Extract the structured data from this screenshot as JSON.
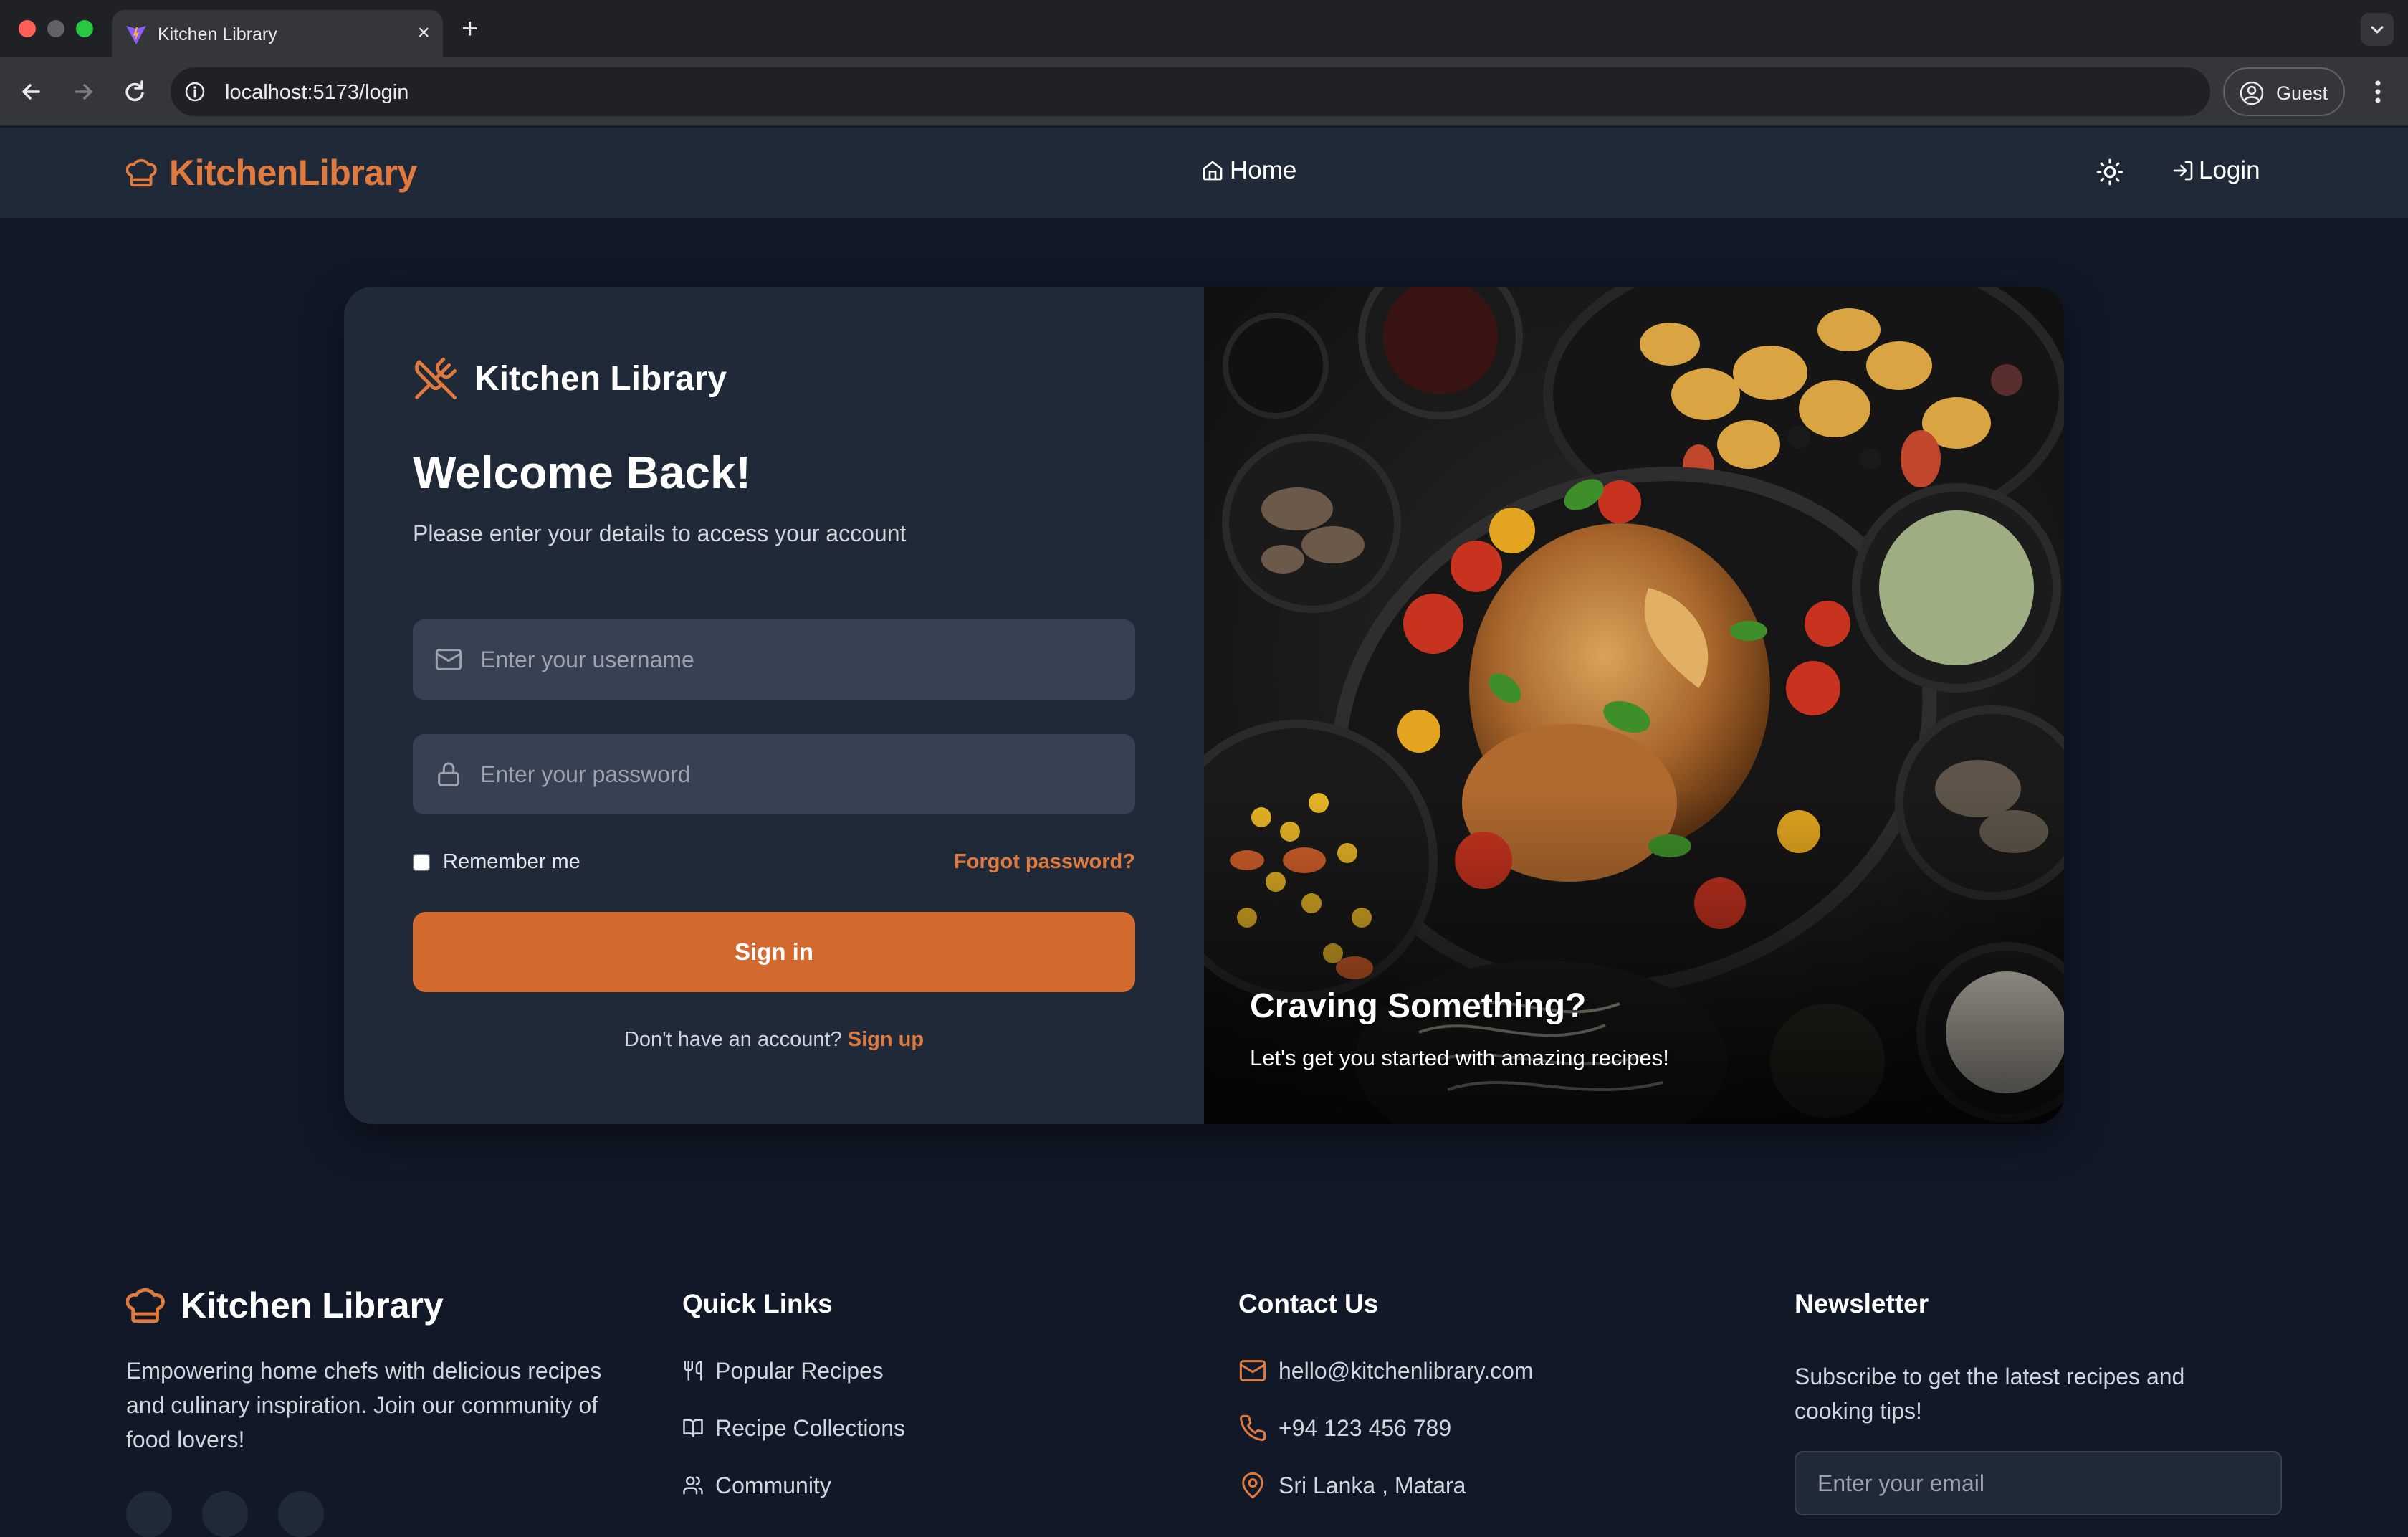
{
  "browser": {
    "tab_title": "Kitchen Library",
    "url": "localhost:5173/login",
    "profile_label": "Guest"
  },
  "header": {
    "brand": "KitchenLibrary",
    "nav_home": "Home",
    "login": "Login"
  },
  "login": {
    "brand": "Kitchen Library",
    "title": "Welcome Back!",
    "subtitle": "Please enter your details to access your account",
    "username_placeholder": "Enter your username",
    "password_placeholder": "Enter your password",
    "remember_me": "Remember me",
    "forgot_password": "Forgot password?",
    "sign_in": "Sign in",
    "no_account": "Don't have an account?",
    "sign_up": "Sign up"
  },
  "hero": {
    "title": "Craving Something?",
    "subtitle": "Let's get you started with amazing recipes!"
  },
  "footer": {
    "brand": "Kitchen Library",
    "description": "Empowering home chefs with delicious recipes and culinary inspiration. Join our community of food lovers!",
    "quick_links": {
      "title": "Quick Links",
      "items": [
        "Popular Recipes",
        "Recipe Collections",
        "Community"
      ]
    },
    "contact": {
      "title": "Contact Us",
      "email": "hello@kitchenlibrary.com",
      "phone": "+94 123 456 789",
      "location": "Sri Lanka , Matara"
    },
    "newsletter": {
      "title": "Newsletter",
      "description": "Subscribe to get the latest recipes and cooking tips!",
      "email_placeholder": "Enter your email"
    }
  },
  "colors": {
    "accent": "#e07a3f",
    "button": "#d2692f",
    "page_bg": "#111827",
    "surface": "#1f2937",
    "input_bg": "#374151"
  }
}
